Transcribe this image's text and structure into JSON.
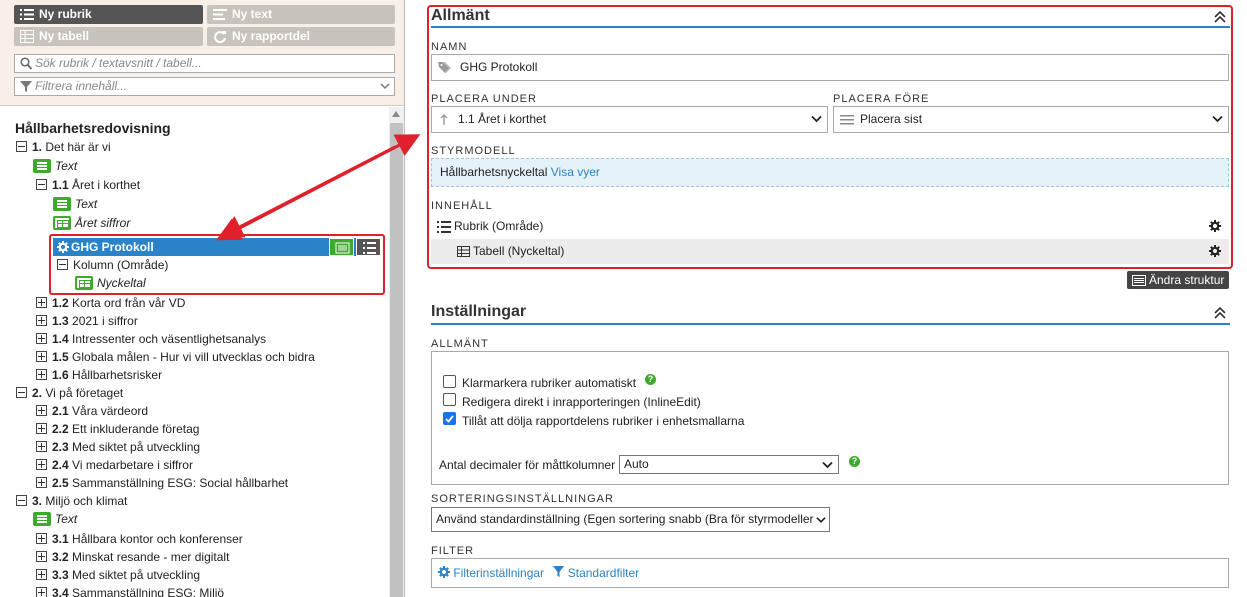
{
  "toolbar": {
    "new_heading": "Ny rubrik",
    "new_text": "Ny text",
    "new_table": "Ny tabell",
    "new_report_part": "Ny rapportdel",
    "search_placeholder": "Sök rubrik / textavsnitt / tabell...",
    "filter_placeholder": "Filtrera innehåll..."
  },
  "tree": {
    "title": "Hållbarhetsredovisning",
    "items": [
      {
        "num": "1.",
        "label": "Det här är vi"
      },
      {
        "label": "Text"
      },
      {
        "num": "1.1",
        "label": "Året i korthet"
      },
      {
        "label": "Text"
      },
      {
        "label": "Året siffror"
      },
      {
        "label": "GHG Protokoll"
      },
      {
        "label": "Kolumn (Område)"
      },
      {
        "label": "Nyckeltal"
      },
      {
        "num": "1.2",
        "label": "Korta ord från vår VD"
      },
      {
        "num": "1.3",
        "label": "2021 i siffror"
      },
      {
        "num": "1.4",
        "label": "Intressenter och väsentlighetsanalys"
      },
      {
        "num": "1.5",
        "label": "Globala målen - Hur vi vill utvecklas och bidra"
      },
      {
        "num": "1.6",
        "label": "Hållbarhetsrisker"
      },
      {
        "num": "2.",
        "label": "Vi på företaget"
      },
      {
        "num": "2.1",
        "label": "Våra värdeord"
      },
      {
        "num": "2.2",
        "label": "Ett inkluderande företag"
      },
      {
        "num": "2.3",
        "label": "Med siktet på utveckling"
      },
      {
        "num": "2.4",
        "label": "Vi medarbetare i siffror"
      },
      {
        "num": "2.5",
        "label": "Sammanställning ESG: Social hållbarhet"
      },
      {
        "num": "3.",
        "label": "Miljö och klimat"
      },
      {
        "label": "Text"
      },
      {
        "num": "3.1",
        "label": "Hållbara kontor och konferenser"
      },
      {
        "num": "3.2",
        "label": "Minskat resande - mer digitalt"
      },
      {
        "num": "3.3",
        "label": "Med siktet på utveckling"
      },
      {
        "num": "3.4",
        "label": "Sammanställning ESG: Miljö"
      }
    ]
  },
  "general": {
    "title": "Allmänt",
    "name_label": "NAMN",
    "name_value": "GHG Protokoll",
    "place_under_label": "PLACERA UNDER",
    "place_under_value": "1.1 Året i korthet",
    "place_before_label": "PLACERA FÖRE",
    "place_before_value": "Placera sist",
    "model_label": "STYRMODELL",
    "model_value": "Hållbarhetsnyckeltal",
    "model_link": "Visa vyer",
    "content_label": "INNEHÅLL",
    "content_rows": [
      "Rubrik (Område)",
      "Tabell (Nyckeltal)"
    ],
    "change_structure": "Ändra struktur"
  },
  "settings": {
    "title": "Inställningar",
    "general_label": "ALLMÄNT",
    "checkboxes": [
      {
        "label": "Klarmarkera rubriker automatiskt",
        "checked": false
      },
      {
        "label": "Redigera direkt i inrapporteringen (InlineEdit)",
        "checked": false
      },
      {
        "label": "Tillåt att dölja rapportdelens rubriker i enhetsmallarna",
        "checked": true
      }
    ],
    "decimals_label": "Antal decimaler för måttkolumner",
    "decimals_value": "Auto",
    "sort_label": "SORTERINGSINSTÄLLNINGAR",
    "sort_value": "Använd standardinställning (Egen sortering snabb (Bra för styrmodeller",
    "filter_label": "FILTER",
    "filter_settings": "Filterinställningar",
    "standard_filter": "Standardfilter"
  },
  "colors": {
    "accent": "#2a83c6",
    "green": "#3daa2b",
    "highlight": "#e0202a"
  }
}
